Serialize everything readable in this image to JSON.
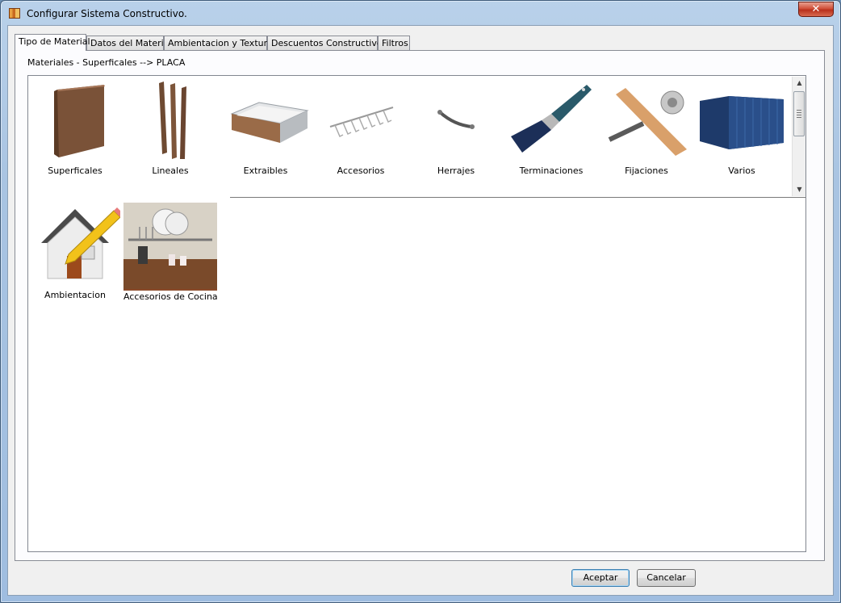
{
  "window": {
    "title": "Configurar Sistema Constructivo.",
    "close_glyph": "✕"
  },
  "tabs": [
    {
      "label": "Tipo de Material",
      "active": true
    },
    {
      "label": "Datos del Material"
    },
    {
      "label": "Ambientacion y Texturas"
    },
    {
      "label": "Descuentos Constructivos"
    },
    {
      "label": "Filtros"
    }
  ],
  "breadcrumb": "Materiales - Superficales --> PLACA",
  "items": [
    {
      "label": "Superficales",
      "icon": "board-panel-icon"
    },
    {
      "label": "Lineales",
      "icon": "linear-strips-icon"
    },
    {
      "label": "Extraibles",
      "icon": "drawer-icon"
    },
    {
      "label": "Accesorios",
      "icon": "accessories-rack-icon"
    },
    {
      "label": "Herrajes",
      "icon": "handle-icon"
    },
    {
      "label": "Terminaciones",
      "icon": "paintbrush-icon"
    },
    {
      "label": "Fijaciones",
      "icon": "fastener-icon"
    },
    {
      "label": "Varios",
      "icon": "container-icon"
    },
    {
      "label": "Ambientacion",
      "icon": "house-pencil-icon"
    },
    {
      "label": "Accesorios de Cocina",
      "icon": "kitchen-rack-icon"
    }
  ],
  "buttons": {
    "ok": "Aceptar",
    "cancel": "Cancelar"
  },
  "colors": {
    "wood": "#8a5a3c",
    "title_bar": "#a9c4e2",
    "close": "#c8402a"
  }
}
